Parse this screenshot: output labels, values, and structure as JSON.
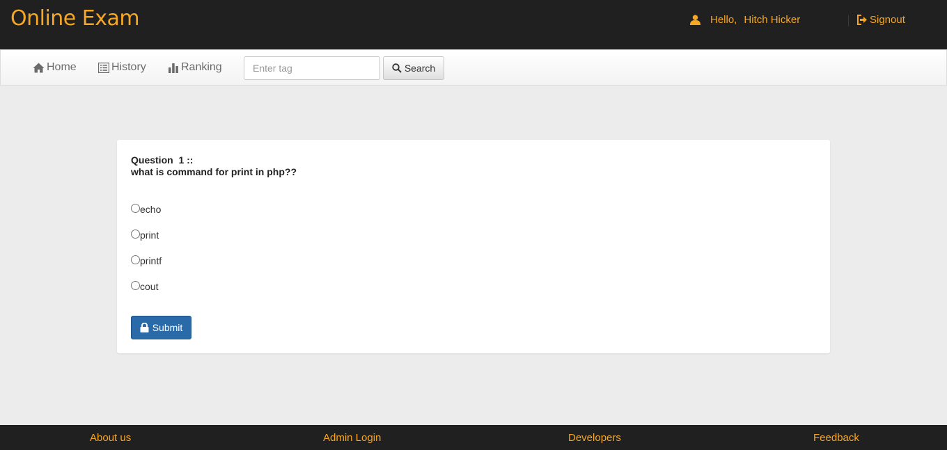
{
  "header": {
    "brand": "Online Exam",
    "greeting": "Hello,",
    "username": "Hitch Hicker",
    "signout": "Signout",
    "accent_color": "#f6a623",
    "user_icon": "user-icon",
    "signout_icon": "log-out-icon"
  },
  "nav": {
    "home": "Home",
    "history": "History",
    "ranking": "Ranking",
    "search_placeholder": "Enter tag",
    "search_button": "Search"
  },
  "question": {
    "title": "Question  1 ::",
    "text": "what is command for print in php??",
    "options": [
      "echo",
      "print",
      "printf",
      "cout"
    ],
    "submit": "Submit"
  },
  "footer": {
    "links": [
      "About us",
      "Admin Login",
      "Developers",
      "Feedback"
    ]
  }
}
